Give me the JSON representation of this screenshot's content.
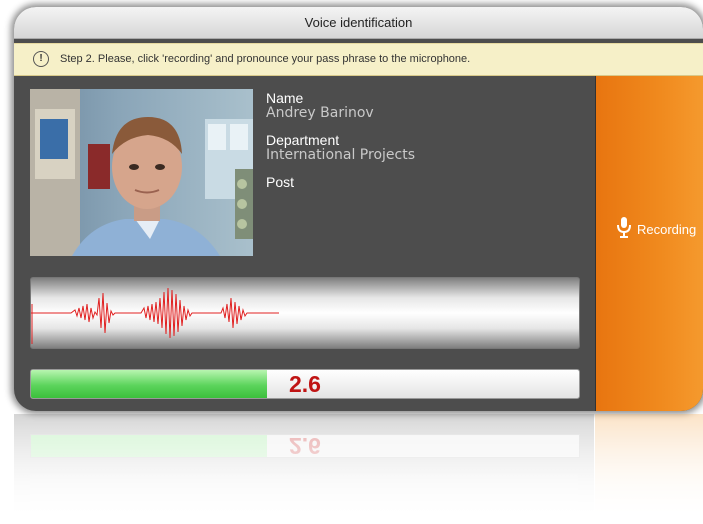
{
  "window": {
    "title": "Voice identification"
  },
  "notice": {
    "icon": "exclamation-icon",
    "text": "Step 2. Please, click 'recording' and pronounce your pass phrase to the microphone."
  },
  "profile": {
    "name_label": "Name",
    "name_value": "Andrey Barinov",
    "department_label": "Department",
    "department_value": "International Projects",
    "post_label": "Post",
    "post_value": ""
  },
  "score": {
    "value_text": "2.6",
    "fill_fraction": 0.43
  },
  "record": {
    "label": "Recording",
    "icon": "microphone-icon"
  },
  "colors": {
    "accent_orange": "#f08a1e",
    "score_green": "#5cd45c",
    "score_red": "#c01414",
    "wave_red": "#e02020"
  }
}
